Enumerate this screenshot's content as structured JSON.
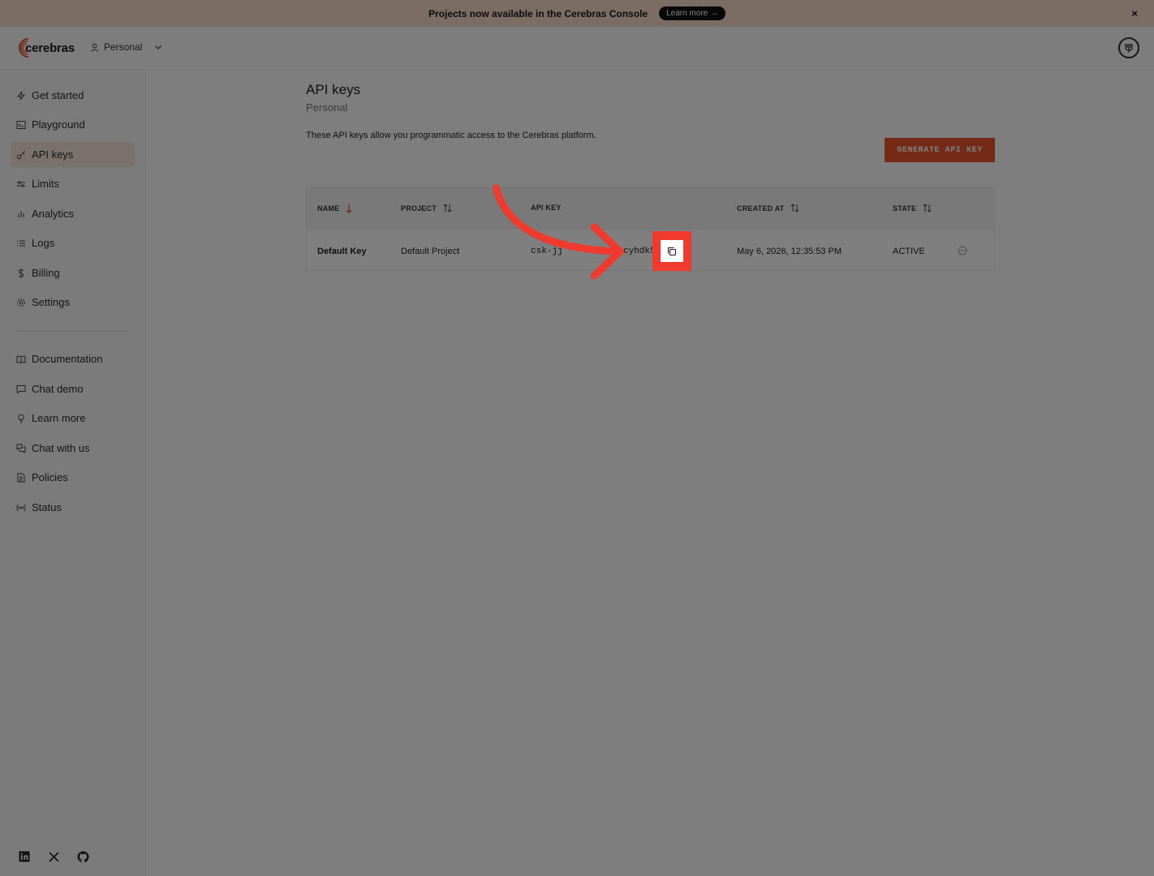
{
  "banner": {
    "text": "Projects now available in the Cerebras Console",
    "button_label": "Learn more →",
    "close_label": "×"
  },
  "header": {
    "logo_text": "cerebras",
    "workspace_label": "Personal"
  },
  "sidebar": {
    "items": [
      {
        "label": "Get started",
        "icon": "bolt-icon"
      },
      {
        "label": "Playground",
        "icon": "terminal-icon"
      },
      {
        "label": "API keys",
        "icon": "key-icon"
      },
      {
        "label": "Limits",
        "icon": "sliders-icon"
      },
      {
        "label": "Analytics",
        "icon": "bar-chart-icon"
      },
      {
        "label": "Logs",
        "icon": "list-icon"
      },
      {
        "label": "Billing",
        "icon": "dollar-icon"
      },
      {
        "label": "Settings",
        "icon": "gear-icon"
      }
    ],
    "secondary_items": [
      {
        "label": "Documentation",
        "icon": "book-icon"
      },
      {
        "label": "Chat demo",
        "icon": "chat-icon"
      },
      {
        "label": "Learn more",
        "icon": "lightbulb-icon"
      },
      {
        "label": "Chat with us",
        "icon": "chats-icon"
      },
      {
        "label": "Policies",
        "icon": "document-icon"
      },
      {
        "label": "Status",
        "icon": "broadcast-icon"
      }
    ],
    "active": "API keys",
    "social": [
      "linkedin-icon",
      "x-icon",
      "github-icon"
    ]
  },
  "page": {
    "title": "API keys",
    "subtitle": "Personal",
    "description": "These API keys allow you programmatic access to the Cerebras platform.",
    "generate_button": "GENERATE API KEY"
  },
  "table": {
    "headers": {
      "name": "NAME",
      "project": "PROJECT",
      "api_key": "API KEY",
      "created_at": "CREATED AT",
      "state": "STATE"
    },
    "rows": [
      {
        "name": "Default Key",
        "project": "Default Project",
        "api_key_start": "csk-jj",
        "api_key_end": "cyhdk5",
        "created_at": "May 6, 2026, 12:35:53 PM",
        "state": "ACTIVE"
      }
    ]
  },
  "colors": {
    "accent": "#e8552a",
    "annotation": "#f03a2e"
  }
}
